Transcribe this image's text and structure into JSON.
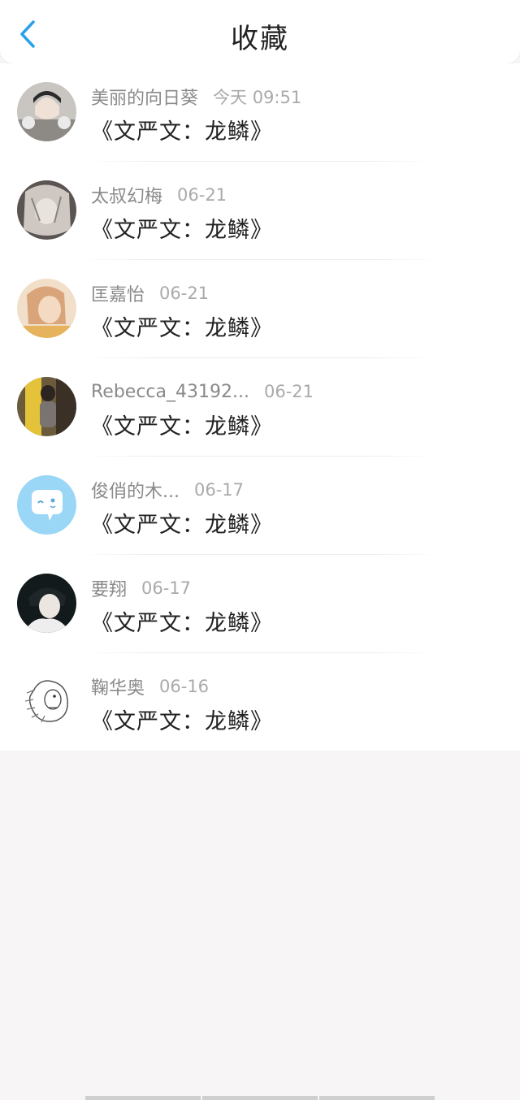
{
  "header": {
    "title": "收藏",
    "back_icon": "chevron-left-icon",
    "accent_color": "#2aa0ea"
  },
  "favorites": [
    {
      "user": "美丽的向日葵",
      "date": "今天 09:51",
      "content": "《文严文：龙鳞》"
    },
    {
      "user": "太叔幻梅",
      "date": "06-21",
      "content": "《文严文：龙鳞》"
    },
    {
      "user": "匡嘉怡",
      "date": "06-21",
      "content": "《文严文：龙鳞》"
    },
    {
      "user": "Rebecca_43192...",
      "date": "06-21",
      "content": "《文严文：龙鳞》"
    },
    {
      "user": "俊俏的木...",
      "date": "06-17",
      "content": "《文严文：龙鳞》"
    },
    {
      "user": "要翔",
      "date": "06-17",
      "content": "《文严文：龙鳞》"
    },
    {
      "user": "鞠华奥",
      "date": "06-16",
      "content": "《文严文：龙鳞》"
    }
  ]
}
